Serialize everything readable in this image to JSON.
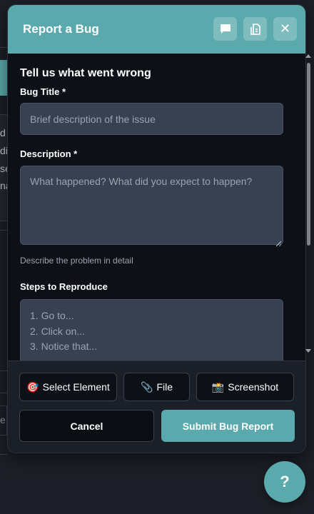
{
  "background": {
    "fragments": [
      "d",
      "di",
      "se",
      "na"
    ],
    "input_fragment": "e"
  },
  "dialog": {
    "title": "Report a Bug",
    "header_buttons": [
      {
        "name": "chat-icon"
      },
      {
        "name": "document-icon"
      },
      {
        "name": "close-icon",
        "glyph": "✕"
      }
    ],
    "heading": "Tell us what went wrong",
    "fields": {
      "title": {
        "label": "Bug Title *",
        "placeholder": "Brief description of the issue",
        "value": ""
      },
      "description": {
        "label": "Description *",
        "placeholder": "What happened? What did you expect to happen?",
        "value": "",
        "help": "Describe the problem in detail"
      },
      "steps": {
        "label": "Steps to Reproduce",
        "placeholder_lines": [
          "1. Go to...",
          "2. Click on...",
          "3. Notice that..."
        ]
      }
    },
    "tools": {
      "select_element": {
        "icon": "🎯",
        "label": "Select Element"
      },
      "file": {
        "icon": "📎",
        "label": "File"
      },
      "screenshot": {
        "icon": "📸",
        "label": "Screenshot"
      }
    },
    "actions": {
      "cancel": "Cancel",
      "submit": "Submit Bug Report"
    }
  },
  "help_button": {
    "label": "?"
  },
  "colors": {
    "accent": "#5aa9ac",
    "dialog_bg": "#0d1016",
    "input_bg": "#374151",
    "footer_bg": "#1b1f27",
    "page_bg": "#1c1f27"
  }
}
